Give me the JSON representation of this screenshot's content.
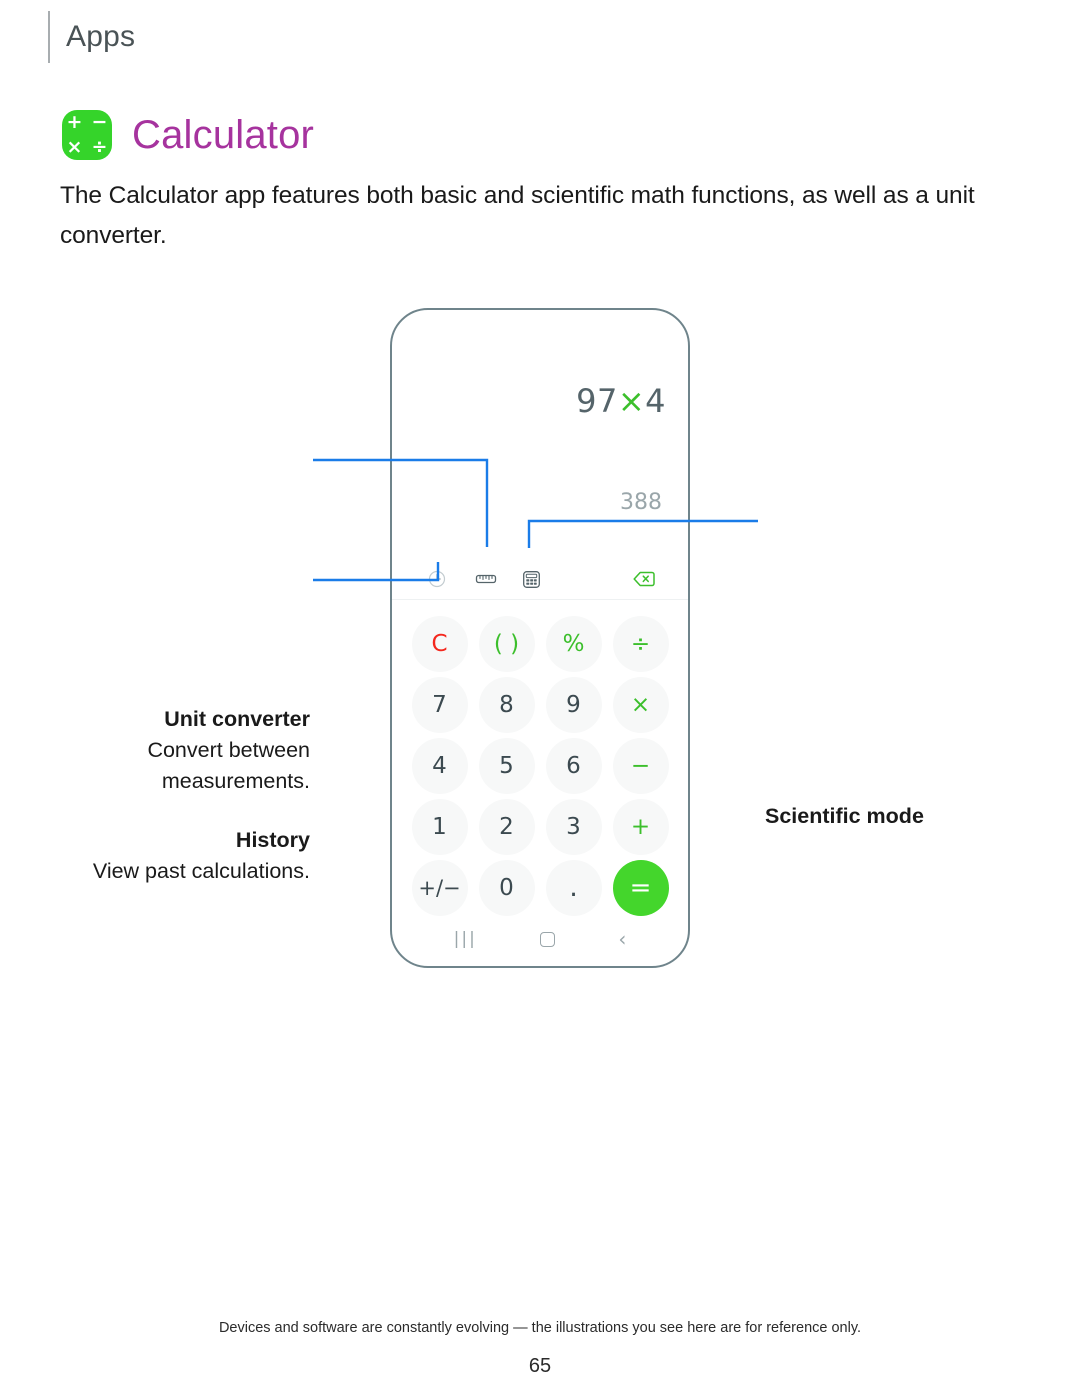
{
  "header": {
    "title": "Apps"
  },
  "section": {
    "title": "Calculator",
    "icon_name": "calculator-app-icon",
    "icon_glyphs": [
      "+",
      "−",
      "×",
      "÷"
    ],
    "accent_color": "#a6339e",
    "icon_color": "#35d42a"
  },
  "intro": {
    "text": "The Calculator app features both basic and scientific math functions, as well as a unit converter."
  },
  "phone": {
    "display": {
      "expression_left": "97",
      "expression_op": "×",
      "expression_right": "4",
      "result": "388"
    },
    "toolbar": [
      {
        "name": "history-icon",
        "label": "History"
      },
      {
        "name": "ruler-icon",
        "label": "Unit converter"
      },
      {
        "name": "scientific-calculator-icon",
        "label": "Scientific mode"
      },
      {
        "name": "backspace-icon",
        "label": "Backspace"
      }
    ],
    "keypad": [
      {
        "label": "C",
        "kind": "clear"
      },
      {
        "label": "( )",
        "kind": "op"
      },
      {
        "label": "%",
        "kind": "op"
      },
      {
        "label": "÷",
        "kind": "op"
      },
      {
        "label": "7",
        "kind": "num"
      },
      {
        "label": "8",
        "kind": "num"
      },
      {
        "label": "9",
        "kind": "num"
      },
      {
        "label": "×",
        "kind": "op"
      },
      {
        "label": "4",
        "kind": "num"
      },
      {
        "label": "5",
        "kind": "num"
      },
      {
        "label": "6",
        "kind": "num"
      },
      {
        "label": "−",
        "kind": "op"
      },
      {
        "label": "1",
        "kind": "num"
      },
      {
        "label": "2",
        "kind": "num"
      },
      {
        "label": "3",
        "kind": "num"
      },
      {
        "label": "+",
        "kind": "op"
      },
      {
        "label": "+/−",
        "kind": "sign"
      },
      {
        "label": "0",
        "kind": "num"
      },
      {
        "label": ".",
        "kind": "dot"
      },
      {
        "label": "=",
        "kind": "equals"
      }
    ],
    "navbar": {
      "recents": "|||",
      "home": "",
      "back": "‹"
    }
  },
  "callouts": {
    "unit_converter": {
      "title": "Unit converter",
      "body": "Convert between measurements."
    },
    "history": {
      "title": "History",
      "body": "View past calculations."
    },
    "scientific_mode": {
      "title": "Scientific mode",
      "body": ""
    },
    "line_color": "#1a7ce8"
  },
  "footer": {
    "note": "Devices and software are constantly evolving — the illustrations you see here are for reference only.",
    "page_number": "65"
  }
}
